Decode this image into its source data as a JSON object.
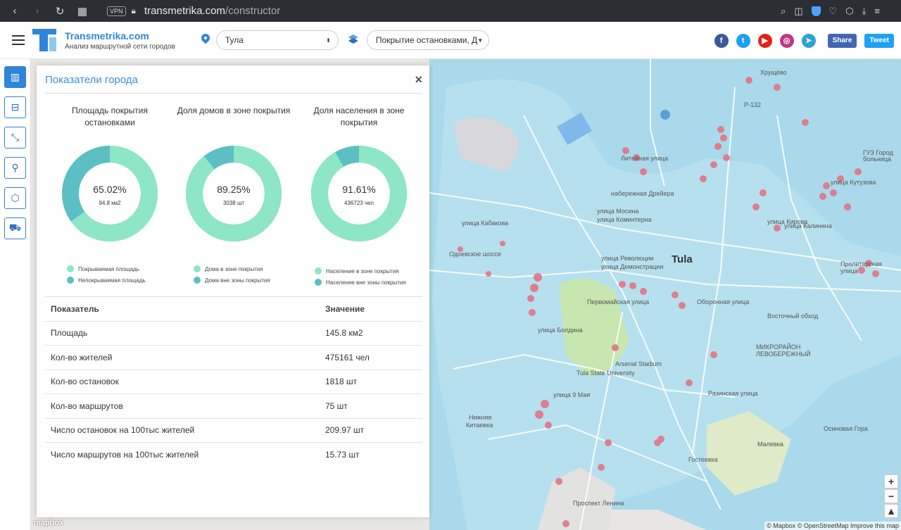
{
  "browser": {
    "url_host": "transmetrika.com",
    "url_path": "/constructor",
    "vpn_label": "VPN"
  },
  "header": {
    "brand_name": "Transmetrika.com",
    "brand_subtitle": "Анализ маршрутной сети городов",
    "city_select": "Тула",
    "layer_select": "Покрытие остановками, Д",
    "share_fb": "Share",
    "share_tw": "Tweet"
  },
  "map": {
    "city_label": "Tula",
    "labels": [
      "Хрущёво",
      "Р-132",
      "ГУЗ Город",
      "больница",
      "Литейная улица",
      "набережная Дрейера",
      "улица Мосина",
      "улица Коминтерна",
      "улица Кабакова",
      "Одоевское шоссе",
      "улица Революции",
      "улица Демонстрации",
      "Первомайская улица",
      "улица Болдина",
      "Arsenal Stadium",
      "Tula State University",
      "улица 9 Мая",
      "Нижняя",
      "Китаевка",
      "Оборонная улица",
      "Восточный обход",
      "МИКРОРАЙОН",
      "ЛЕВОБЕРЕЖНЫЙ",
      "Осиновая Гора",
      "Малевка",
      "Гостеевка",
      "Разинская улица",
      "улица Кутузова",
      "улица Кирова",
      "улица Калинина",
      "Проспект Ленина",
      "Пролетарская улица"
    ],
    "attribution": "© Mapbox © OpenStreetMap  Improve this map",
    "mapbox_logo": "mapbox"
  },
  "panel": {
    "title": "Показатели города",
    "close": "×",
    "cards": [
      {
        "title": "Площадь покрытия остановками",
        "percent_label": "65.02%",
        "absolute_label": "94.8 км2",
        "fraction": 0.6502,
        "legend": [
          "Покрываемая площадь",
          "Непокрываемая площадь"
        ]
      },
      {
        "title": "Доля домов в зоне покрытия",
        "percent_label": "89.25%",
        "absolute_label": "3038 шт",
        "fraction": 0.8925,
        "legend": [
          "Дома в зоне покрытия",
          "Дома вне зоны покрытия"
        ]
      },
      {
        "title": "Доля населения в зоне покрытия",
        "percent_label": "91.61%",
        "absolute_label": "436723 чел",
        "fraction": 0.9161,
        "legend": [
          "Население в зоне покрытия",
          "Население вне зоны покрытия"
        ]
      }
    ],
    "colors": {
      "covered": "#8de6c6",
      "uncovered": "#5bbfc4",
      "title": "#3a8fd8"
    },
    "table": {
      "headers": [
        "Показатель",
        "Значение"
      ],
      "rows": [
        [
          "Площадь",
          "145.8 км2"
        ],
        [
          "Кол-во жителей",
          "475161 чел"
        ],
        [
          "Кол-во остановок",
          "1818 шт"
        ],
        [
          "Кол-во маршрутов",
          "75 шт"
        ],
        [
          "Число остановок на 100тыс жителей",
          "209.97 шт"
        ],
        [
          "Число маршрутов на 100тыс жителей",
          "15.73 шт"
        ]
      ]
    }
  }
}
